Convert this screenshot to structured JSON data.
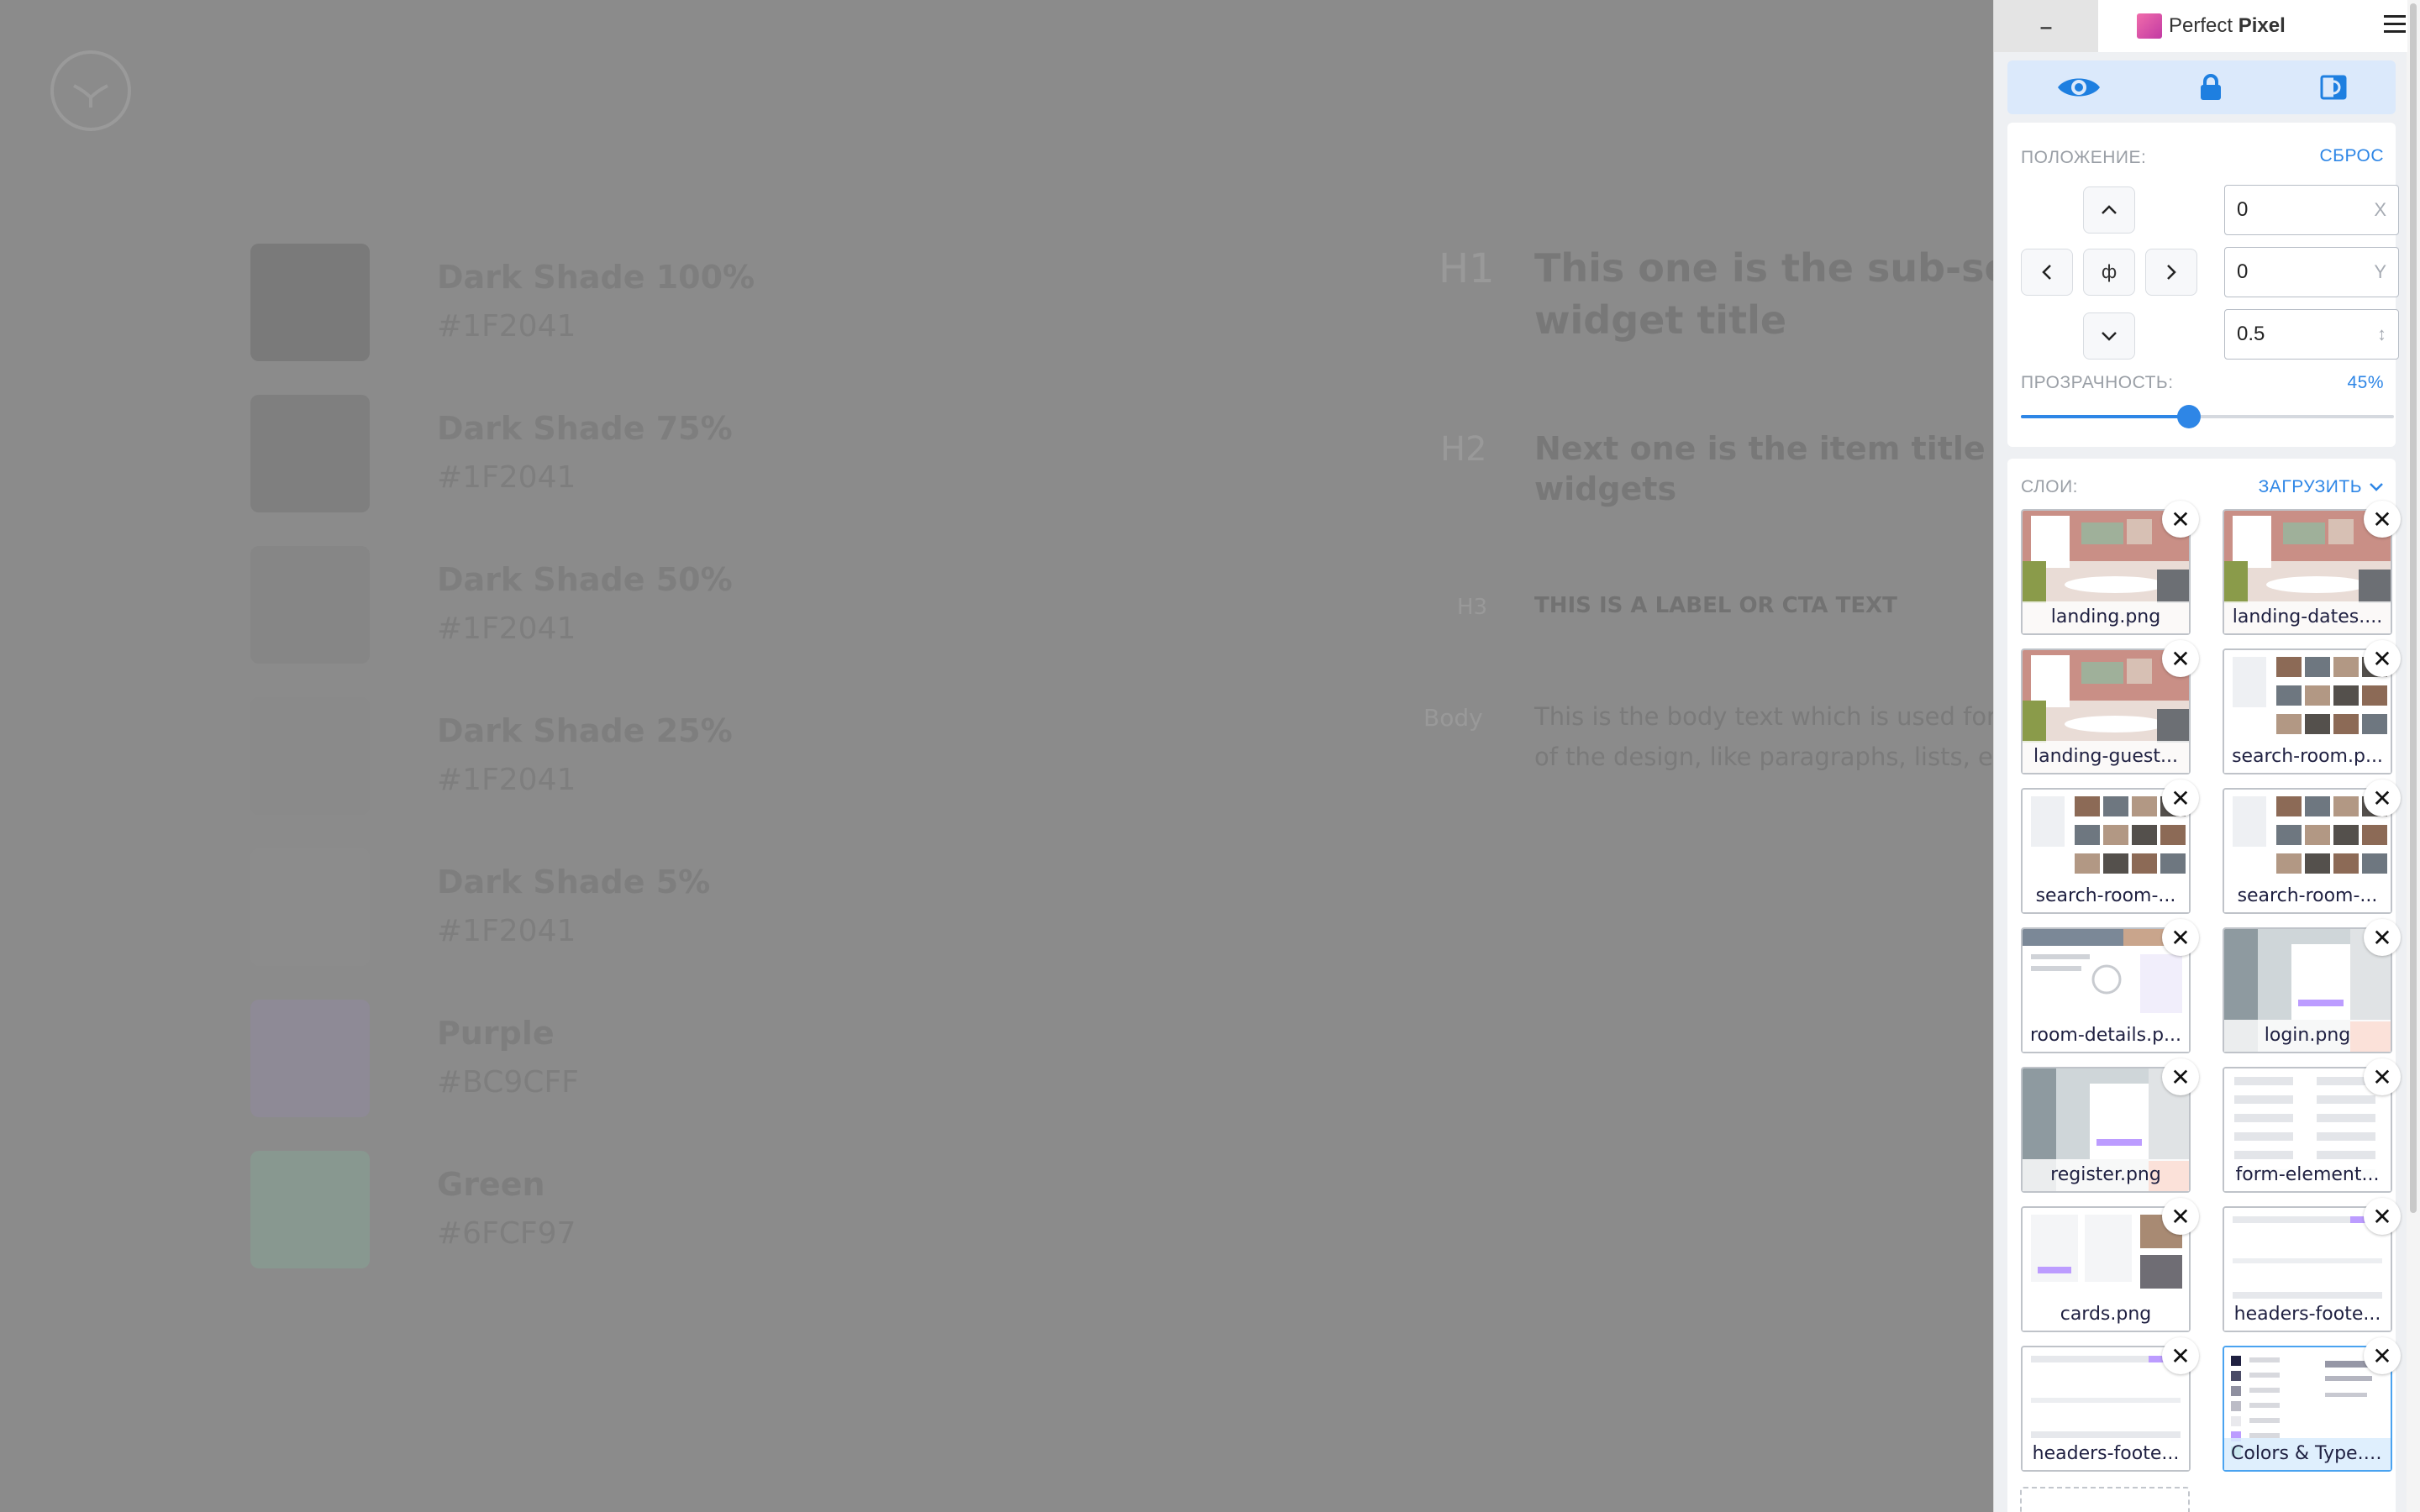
{
  "page": {
    "swatches": [
      {
        "name": "Dark Shade 100%",
        "hex": "#1F2041",
        "color": "#7a7a7a"
      },
      {
        "name": "Dark Shade 75%",
        "hex": "#1F2041",
        "color": "#7f7f7f"
      },
      {
        "name": "Dark Shade 50%",
        "hex": "#1F2041",
        "color": "#868686"
      },
      {
        "name": "Dark Shade 25%",
        "hex": "#1F2041",
        "color": "#8a8a8a"
      },
      {
        "name": "Dark Shade 5%",
        "hex": "#1F2041",
        "color": "#8c8c8c"
      },
      {
        "name": "Purple",
        "hex": "#BC9CFF",
        "color": "#8e8a96"
      },
      {
        "name": "Green",
        "hex": "#6FCF97",
        "color": "#889890"
      }
    ],
    "type": {
      "h1_label": "H1",
      "h1_line1": "This one is the sub-secti",
      "h1_line2": "widget title",
      "h2_label": "H2",
      "h2_line1": "Next one is the item title insid",
      "h2_line2": "widgets",
      "h3_label": "H3",
      "h3_text": "THIS IS A LABEL OR CTA TEXT",
      "body_label": "Body",
      "body_line1": "This is the body text which is used for m",
      "body_line2": "of the design, like paragraphs, lists, etc."
    }
  },
  "panel": {
    "minimize": "–",
    "title_light": "Perfect ",
    "title_bold": "Pixel",
    "modes": [
      "eye-icon",
      "lock-icon",
      "invert-icon"
    ],
    "position": {
      "heading": "ПОЛОЖЕНИЕ:",
      "reset": "СБРОС",
      "center_glyph": "ф",
      "x_value": "0",
      "x_suffix": "X",
      "y_value": "0",
      "y_suffix": "Y",
      "scale_value": "0.5",
      "scale_suffix": "↕"
    },
    "opacity": {
      "heading": "ПРОЗРАЧНОСТЬ:",
      "value_text": "45%",
      "value": 0.45
    },
    "layers": {
      "heading": "СЛОИ:",
      "upload": "ЗАГРУЗИТЬ",
      "close_glyph": "✕",
      "items": [
        {
          "label": "landing.png",
          "thumb": "photo"
        },
        {
          "label": "landing-dates....",
          "thumb": "photo"
        },
        {
          "label": "landing-guest...",
          "thumb": "photo"
        },
        {
          "label": "search-room.p...",
          "thumb": "grid"
        },
        {
          "label": "search-room-...",
          "thumb": "grid"
        },
        {
          "label": "search-room-...",
          "thumb": "grid"
        },
        {
          "label": "room-details.p...",
          "thumb": "details"
        },
        {
          "label": "login.png",
          "thumb": "login"
        },
        {
          "label": "register.png",
          "thumb": "login"
        },
        {
          "label": "form-element...",
          "thumb": "form"
        },
        {
          "label": "cards.png",
          "thumb": "cards"
        },
        {
          "label": "headers-foote...",
          "thumb": "headers"
        },
        {
          "label": "headers-foote...",
          "thumb": "headers"
        },
        {
          "label": "Colors & Type.j...",
          "thumb": "colors",
          "active": true
        }
      ]
    }
  }
}
